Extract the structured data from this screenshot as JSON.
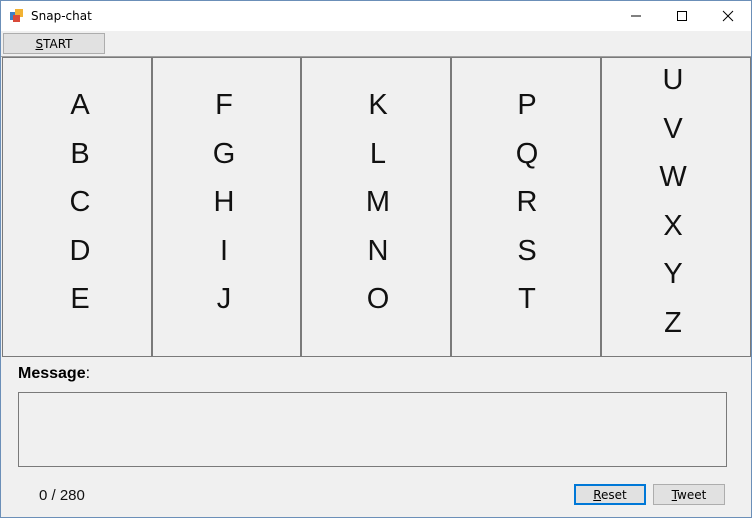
{
  "window": {
    "title": "Snap-chat",
    "icon": "app-icon"
  },
  "toolbar": {
    "start_label": "START"
  },
  "letter_groups": [
    {
      "letters": [
        "A",
        "B",
        "C",
        "D",
        "E"
      ]
    },
    {
      "letters": [
        "F",
        "G",
        "H",
        "I",
        "J"
      ]
    },
    {
      "letters": [
        "K",
        "L",
        "M",
        "N",
        "O"
      ]
    },
    {
      "letters": [
        "P",
        "Q",
        "R",
        "S",
        "T"
      ]
    },
    {
      "letters": [
        "U",
        "V",
        "W",
        "X",
        "Y",
        "Z"
      ]
    }
  ],
  "message": {
    "label_bold": "Message",
    "label_suffix": ":",
    "value": "",
    "counter": "0 / 280"
  },
  "buttons": {
    "reset": "Reset",
    "tweet": "Tweet"
  },
  "colors": {
    "focus_border": "#0078d7",
    "window_border": "#6b8fb8",
    "background": "#f0f0f0"
  }
}
